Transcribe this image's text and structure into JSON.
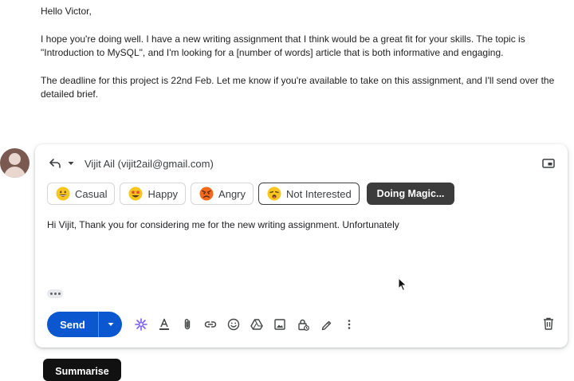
{
  "email": {
    "greeting": "Hello Victor,",
    "paragraph1": "I hope you're doing well. I have a new writing assignment that I think would be a great fit for your skills. The topic is \"Introduction to MySQL\", and I'm looking for a [number of words] article that is both informative and engaging.",
    "paragraph2": "The deadline for this project is 22nd Feb. Let me know if you're available to take on this assignment, and I'll send over the detailed brief."
  },
  "compose": {
    "recipient": "Vijit Ail (vijit2ail@gmail.com)",
    "tones": [
      {
        "label": "Casual",
        "icon": "grinning-face-emoji"
      },
      {
        "label": "Happy",
        "icon": "star-struck-emoji"
      },
      {
        "label": "Angry",
        "icon": "angry-face-emoji"
      },
      {
        "label": "Not Interested",
        "icon": "weary-face-emoji",
        "selected": true
      }
    ],
    "magic_label": "Doing Magic...",
    "draft_text": "Hi Vijit, Thank you for considering me for the new writing assignment. Unfortunately",
    "send_label": "Send",
    "toolbar_icons": [
      "ai-sparkle-icon",
      "text-format-icon",
      "attach-icon",
      "link-icon",
      "emoji-icon",
      "drive-icon",
      "photo-icon",
      "confidential-lock-icon",
      "signature-pen-icon",
      "more-options-icon"
    ]
  },
  "summarise_label": "Summarise",
  "colors": {
    "send_blue": "#0b57d0",
    "magic_bg": "#3c3c3c",
    "summarise_bg": "#111111",
    "sparkle_purple": "#7b5cff"
  }
}
